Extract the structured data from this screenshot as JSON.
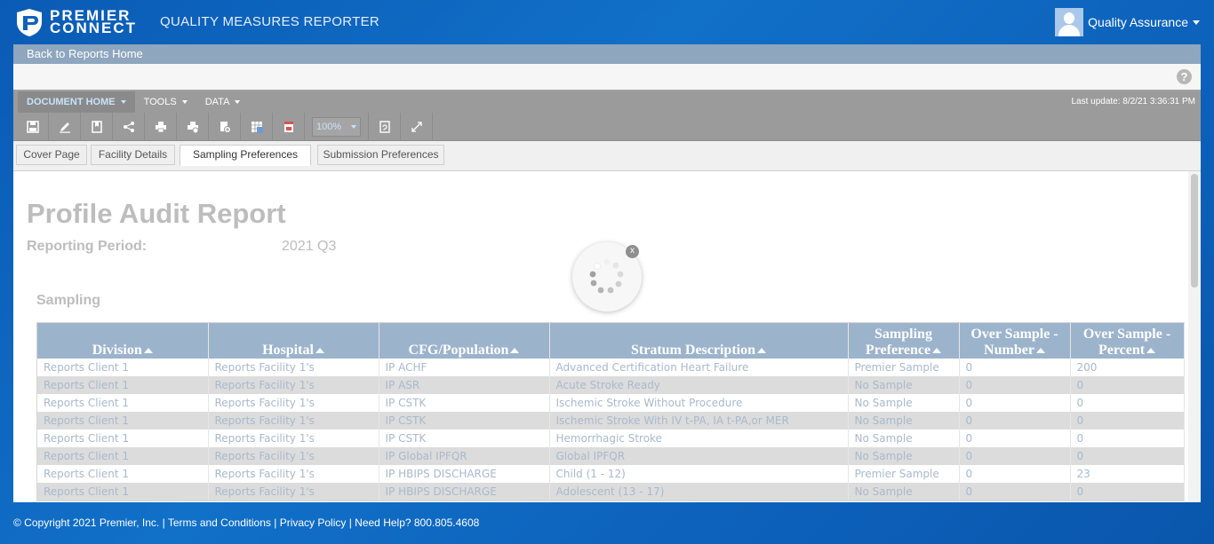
{
  "header": {
    "logo_line1": "PREMIER",
    "logo_line2": "CONNECT",
    "app_title": "QUALITY MEASURES REPORTER",
    "user_name": "Quality Assurance"
  },
  "nav": {
    "back_label": "Back to Reports Home"
  },
  "menu": {
    "items": [
      "DOCUMENT HOME",
      "TOOLS",
      "DATA"
    ],
    "last_update": "Last update: 8/2/21 3:36:31 PM"
  },
  "toolbar": {
    "zoom": "100%",
    "icons": [
      "save-icon",
      "edit-icon",
      "bookmark-icon",
      "share-icon",
      "print-icon",
      "print-options-icon",
      "add-document-icon",
      "export-excel-icon",
      "export-pdf-icon",
      "refresh-icon",
      "fullscreen-icon"
    ]
  },
  "tabs": [
    "Cover Page",
    "Facility Details",
    "Sampling Preferences",
    "Submission Preferences"
  ],
  "active_tab": "Sampling Preferences",
  "report": {
    "title": "Profile Audit Report",
    "period_label": "Reporting Period:",
    "period_value": "2021 Q3",
    "section_title": "Sampling"
  },
  "table": {
    "headers": [
      [
        "Division"
      ],
      [
        "Hospital"
      ],
      [
        "CFG/Population"
      ],
      [
        "Stratum Description"
      ],
      [
        "Sampling",
        "Preference"
      ],
      [
        "Over Sample -",
        "Number"
      ],
      [
        "Over Sample -",
        "Percent"
      ]
    ],
    "rows": [
      [
        "Reports Client 1",
        "Reports Facility 1's",
        "IP ACHF",
        "Advanced Certification Heart Failure",
        "Premier Sample",
        "0",
        "200"
      ],
      [
        "Reports Client 1",
        "Reports Facility 1's",
        "IP ASR",
        "Acute Stroke Ready",
        "No Sample",
        "0",
        "0"
      ],
      [
        "Reports Client 1",
        "Reports Facility 1's",
        "IP CSTK",
        "Ischemic Stroke Without Procedure",
        "No Sample",
        "0",
        "0"
      ],
      [
        "Reports Client 1",
        "Reports Facility 1's",
        "IP CSTK",
        "Ischemic Stroke With IV t-PA, IA t-PA,or MER",
        "No Sample",
        "0",
        "0"
      ],
      [
        "Reports Client 1",
        "Reports Facility 1's",
        "IP CSTK",
        "Hemorrhagic Stroke",
        "No Sample",
        "0",
        "0"
      ],
      [
        "Reports Client 1",
        "Reports Facility 1's",
        "IP Global IPFQR",
        "Global IPFQR",
        "No Sample",
        "0",
        "0"
      ],
      [
        "Reports Client 1",
        "Reports Facility 1's",
        "IP HBIPS DISCHARGE",
        "Child (1 - 12)",
        "Premier Sample",
        "0",
        "23"
      ],
      [
        "Reports Client 1",
        "Reports Facility 1's",
        "IP HBIPS DISCHARGE",
        "Adolescent (13 - 17)",
        "No Sample",
        "0",
        "0"
      ]
    ]
  },
  "loader": {
    "close_label": "x"
  },
  "footer": {
    "copyright": "© Copyright 2021 Premier, Inc. | ",
    "terms": "Terms and Conditions",
    "sep1": " | ",
    "privacy": "Privacy Policy",
    "sep2": " | ",
    "help": "Need Help? 800.805.4608"
  }
}
